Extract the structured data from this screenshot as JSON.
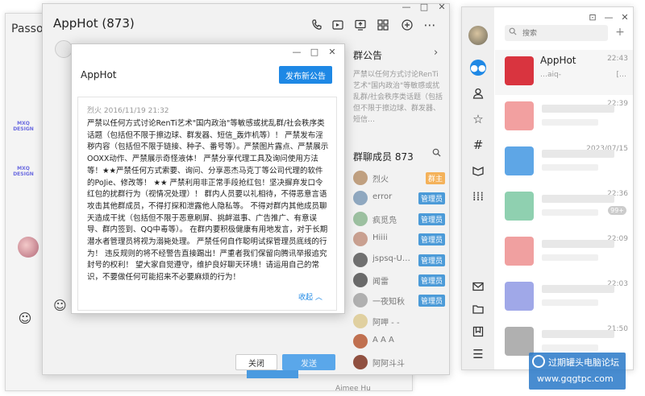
{
  "bg_window": {
    "title": "Passo"
  },
  "main": {
    "title": "AppHot (873)",
    "controls": {
      "minimize": "—",
      "maximize": "□",
      "close": "✕"
    },
    "notice_panel": {
      "title": "群公告",
      "preview": "严禁以任何方式讨论RenTi艺术\"国内政治\"等敏感或扰乱群/社会秩序类话题（包括但不限于擦边球、群发器、短信…"
    },
    "members_panel": {
      "title": "群聊成员 873",
      "members": [
        {
          "name": "烈火",
          "badge": "群主",
          "color": "#c0a080"
        },
        {
          "name": "error",
          "badge": "管理员",
          "color": "#8fa8c0"
        },
        {
          "name": "疯觅凫",
          "badge": "管理员",
          "color": "#9cc0a0"
        },
        {
          "name": "Hiiii",
          "badge": "管理员",
          "color": "#c9a090"
        },
        {
          "name": "jspsq-U…",
          "badge": "管理员",
          "color": "#707070"
        },
        {
          "name": "闻雷",
          "badge": "管理员",
          "color": "#6a6a6a"
        },
        {
          "name": "一夜知秋",
          "badge": "管理员",
          "color": "#b0b0b0"
        },
        {
          "name": "阿呷 - -",
          "badge": "",
          "color": "#e0d0a0"
        },
        {
          "name": "A A A",
          "badge": "",
          "color": "#c07050"
        },
        {
          "name": "阿阿斗斗",
          "badge": "",
          "color": "#905040"
        }
      ]
    },
    "close_label": "关闭",
    "send_label": "发送",
    "bottom_name": "Aimee Hu"
  },
  "notice_dialog": {
    "title": "AppHot",
    "controls": {
      "minimize": "—",
      "maximize": "□",
      "close": "✕"
    },
    "publish_label": "发布新公告",
    "meta": "烈火 2016/11/19 21:32",
    "body": "严禁以任何方式讨论RenTi艺术\"国内政治\"等敏感或扰乱群/社会秩序类话题（包括但不限于擦边球、群发器、短信_轰炸机等）！ 严禁发布淫秽内容（包括但不限于链接、种子、番号等）。严禁图片露点、严禁展示OOXX动作、严禁展示奇怪液体！ 严禁分享代理工具及询问使用方法等！★★严禁任何方式索要、询问、分享恶杰马克丁等公司代理的软件的PoJie、修改等！ ★★ 严禁利用非正常手段抢红包！坚决摒弃发口令红包的扰群行为（视情况处理）！ 群内人员要以礼相待，不得恶意言语攻击其他群成员，不得打探和泄露他人隐私等。 不得对群内其他成员聊天造成干扰（包括但不限于恶意刷屏、挑衅滋事、广告推广、有意误导、群内签到、QQ中毒等）。 在群内要积极健康有用地发言，对于长期潜水者管理员将视为溺毙处理。 严禁任何自作聪明试探管理员底线的行为！ 违反规则的将不经警告直接踢出！严重者我们保留向腾讯举报追究封号的权利！ 望大家自觉遵守，维护良好聊天环境！请运用自己的常识，不要做任何可能招来不必要麻烦的行为！",
    "collapse_label": "收起"
  },
  "list_window": {
    "controls": {
      "pin": "⊡",
      "minimize": "—",
      "close": "✕"
    },
    "search_placeholder": "搜索",
    "add": "+",
    "chats": [
      {
        "name": "AppHot",
        "time": "22:43",
        "preview": "…aiq-",
        "preview_tail": "[…",
        "color": "#d9343f",
        "badge": ""
      },
      {
        "name": "",
        "time": "22:39",
        "preview": "",
        "color": "#f2a0a0",
        "badge": ""
      },
      {
        "name": "",
        "time": "2023/07/15",
        "preview": "",
        "color": "#5ea6e6",
        "badge": ""
      },
      {
        "name": "",
        "time": "22:36",
        "preview": "",
        "color": "#8fd0b0",
        "badge": "99+"
      },
      {
        "name": "",
        "time": "22:09",
        "preview": "",
        "color": "#f0a0a0",
        "badge": ""
      },
      {
        "name": "",
        "time": "22:03",
        "preview": "",
        "color": "#a0a8e8",
        "badge": ""
      },
      {
        "name": "",
        "time": "21:50",
        "preview": "",
        "color": "#b0b0b0",
        "badge": ""
      }
    ]
  },
  "watermark": {
    "line1": "过期罐头电脑论坛",
    "line2": "www.gqgtpc.com"
  }
}
